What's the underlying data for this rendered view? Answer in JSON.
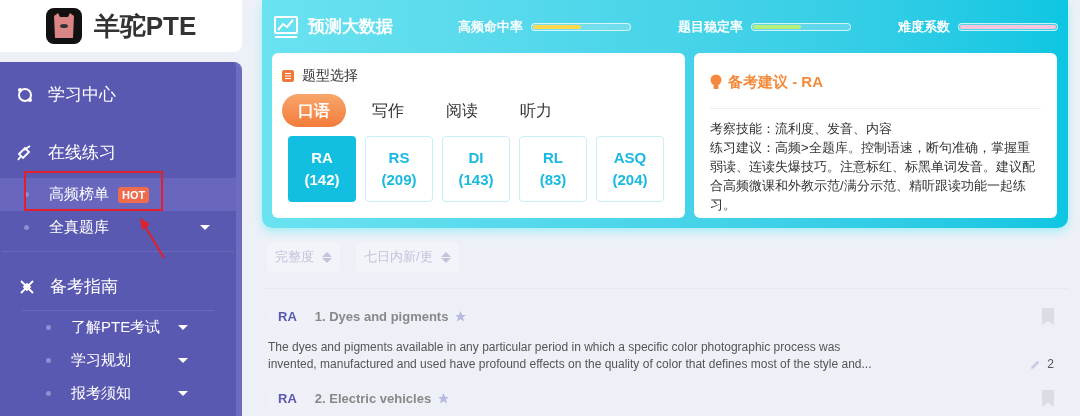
{
  "logo": {
    "text": "羊驼PTE"
  },
  "sidebar": {
    "sections": [
      {
        "label": "学习中心"
      },
      {
        "label": "在线练习",
        "children": [
          {
            "label": "高频榜单",
            "badge": "HOT",
            "selected": true,
            "submenu": false
          },
          {
            "label": "全真题库",
            "selected": false,
            "submenu": true
          }
        ]
      },
      {
        "label": "备考指南",
        "children": [
          {
            "label": "了解PTE考试",
            "selected": false,
            "submenu": true
          },
          {
            "label": "学习规划",
            "selected": false,
            "submenu": true
          },
          {
            "label": "报考须知",
            "selected": false,
            "submenu": true
          }
        ]
      }
    ]
  },
  "header": {
    "title": "预测大数据",
    "meters": [
      {
        "label": "高频命中率",
        "level": 0.5,
        "color": "#ffd84d"
      },
      {
        "label": "题目稳定率",
        "level": 0.5,
        "color": "#b6f07a"
      },
      {
        "label": "难度系数",
        "level": 1,
        "color": "#f7c6dc"
      }
    ]
  },
  "type_select": {
    "title": "题型选择",
    "tabs": [
      {
        "label": "口语",
        "selected": true
      },
      {
        "label": "写作",
        "selected": false
      },
      {
        "label": "阅读",
        "selected": false
      },
      {
        "label": "听力",
        "selected": false
      }
    ],
    "types": [
      {
        "code": "RA",
        "count": "(142)",
        "selected": true
      },
      {
        "code": "RS",
        "count": "(209)",
        "selected": false
      },
      {
        "code": "DI",
        "count": "(143)",
        "selected": false
      },
      {
        "code": "RL",
        "count": "(83)",
        "selected": false
      },
      {
        "code": "ASQ",
        "count": "(204)",
        "selected": false
      }
    ]
  },
  "advice": {
    "title": "备考建议 - RA",
    "lines": [
      "考察技能：流利度、发音、内容",
      "练习建议：高频>全题库。控制语速，断句准确，掌握重弱读、连读失爆技巧。注意标红、标黑单词发音。建议配合高频微课和外教示范/满分示范、精听跟读功能一起练习。"
    ]
  },
  "filters": [
    "完整度",
    "七日内新/更"
  ],
  "questions": [
    {
      "tag": "RA",
      "title": "1. Dyes and pigments",
      "text": "The dyes and pigments available in any particular period in which a specific color photographic process was invented, manufactured and used have profound effects on the quality of color that defines most of the style and...",
      "count": "2"
    },
    {
      "tag": "RA",
      "title": "2. Electric vehicles"
    }
  ]
}
